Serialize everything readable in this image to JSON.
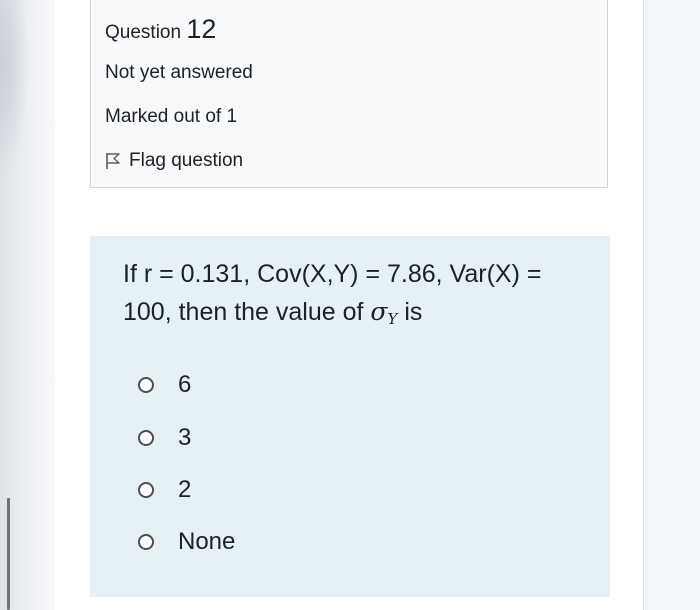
{
  "question_info": {
    "title_prefix": "Question ",
    "number": "12",
    "status": "Not yet answered",
    "marks": "Marked out of 1",
    "flag_label": "Flag question"
  },
  "question": {
    "text": "If r = 0.131, Cov(X,Y) = 7.86, Var(X) = 100, then the value of ",
    "sigma": "σ",
    "sigma_sub": "Y",
    "suffix": " is"
  },
  "options": [
    "6",
    "3",
    "2",
    "None"
  ],
  "colors": {
    "question_bg": "#e6f1f6",
    "info_bg": "#f8f9fa",
    "text": "#1d2125"
  }
}
